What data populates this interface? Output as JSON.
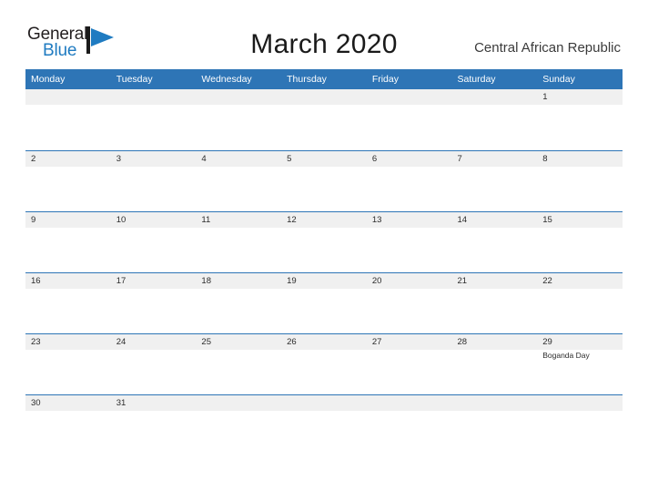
{
  "brand": {
    "name_part1": "General",
    "name_part2": "Blue",
    "mark_icon": "flag-triangle-icon",
    "color_dark": "#231f20",
    "color_blue": "#1f7bc1"
  },
  "header": {
    "month_title": "March 2020",
    "country": "Central African Republic"
  },
  "theme": {
    "header_blue": "#2e75b6",
    "band_gray": "#f0f0f0",
    "text_dark": "#2b2b2b",
    "page_background": "#ffffff"
  },
  "calendar": {
    "weekdays": [
      "Monday",
      "Tuesday",
      "Wednesday",
      "Thursday",
      "Friday",
      "Saturday",
      "Sunday"
    ],
    "weeks": [
      [
        {
          "day": "",
          "event": ""
        },
        {
          "day": "",
          "event": ""
        },
        {
          "day": "",
          "event": ""
        },
        {
          "day": "",
          "event": ""
        },
        {
          "day": "",
          "event": ""
        },
        {
          "day": "",
          "event": ""
        },
        {
          "day": "1",
          "event": ""
        }
      ],
      [
        {
          "day": "2",
          "event": ""
        },
        {
          "day": "3",
          "event": ""
        },
        {
          "day": "4",
          "event": ""
        },
        {
          "day": "5",
          "event": ""
        },
        {
          "day": "6",
          "event": ""
        },
        {
          "day": "7",
          "event": ""
        },
        {
          "day": "8",
          "event": ""
        }
      ],
      [
        {
          "day": "9",
          "event": ""
        },
        {
          "day": "10",
          "event": ""
        },
        {
          "day": "11",
          "event": ""
        },
        {
          "day": "12",
          "event": ""
        },
        {
          "day": "13",
          "event": ""
        },
        {
          "day": "14",
          "event": ""
        },
        {
          "day": "15",
          "event": ""
        }
      ],
      [
        {
          "day": "16",
          "event": ""
        },
        {
          "day": "17",
          "event": ""
        },
        {
          "day": "18",
          "event": ""
        },
        {
          "day": "19",
          "event": ""
        },
        {
          "day": "20",
          "event": ""
        },
        {
          "day": "21",
          "event": ""
        },
        {
          "day": "22",
          "event": ""
        }
      ],
      [
        {
          "day": "23",
          "event": ""
        },
        {
          "day": "24",
          "event": ""
        },
        {
          "day": "25",
          "event": ""
        },
        {
          "day": "26",
          "event": ""
        },
        {
          "day": "27",
          "event": ""
        },
        {
          "day": "28",
          "event": ""
        },
        {
          "day": "29",
          "event": "Boganda Day"
        }
      ],
      [
        {
          "day": "30",
          "event": ""
        },
        {
          "day": "31",
          "event": ""
        },
        {
          "day": "",
          "event": ""
        },
        {
          "day": "",
          "event": ""
        },
        {
          "day": "",
          "event": ""
        },
        {
          "day": "",
          "event": ""
        },
        {
          "day": "",
          "event": ""
        }
      ]
    ]
  }
}
